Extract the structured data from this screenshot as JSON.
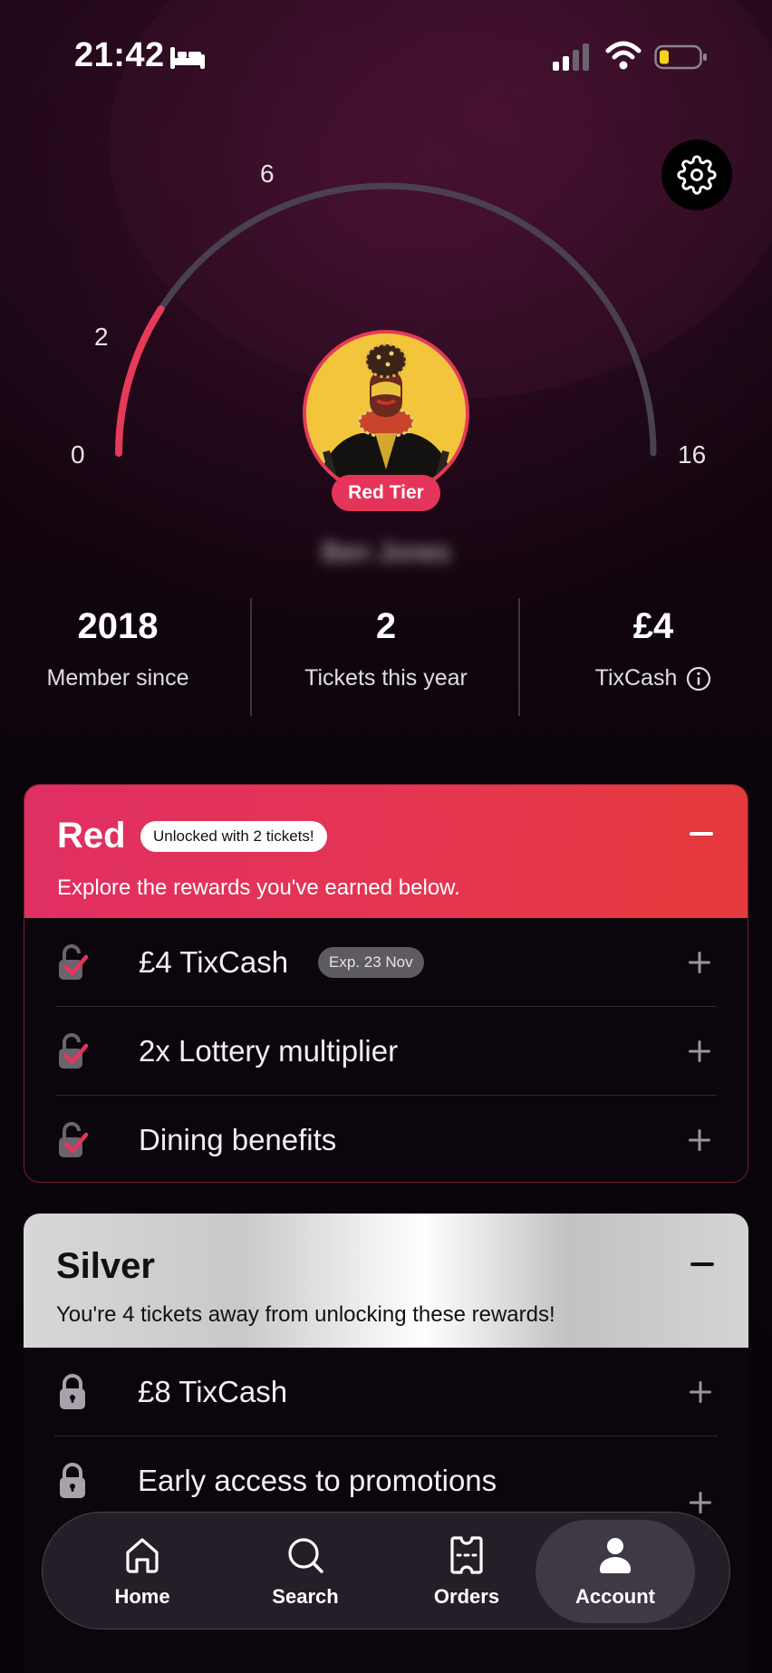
{
  "status_bar": {
    "time": "21:42"
  },
  "gauge": {
    "labels": [
      "0",
      "2",
      "6",
      "16"
    ],
    "progress_tickets": 2,
    "max_tickets": 16,
    "accent": "#e53a59"
  },
  "profile": {
    "tier_badge": "Red Tier",
    "name": "Ben Jones"
  },
  "stats": [
    {
      "value": "2018",
      "label": "Member since"
    },
    {
      "value": "2",
      "label": "Tickets this year"
    },
    {
      "value": "£4",
      "label": "TixCash"
    }
  ],
  "red_tier": {
    "title": "Red",
    "badge": "Unlocked with 2 tickets!",
    "subtitle": "Explore the rewards you've earned below.",
    "rewards": [
      {
        "label": "£4 TixCash",
        "expiry": "Exp. 23 Nov",
        "icon": "unlocked-check-icon"
      },
      {
        "label": "2x Lottery multiplier",
        "icon": "unlocked-check-icon"
      },
      {
        "label": "Dining benefits",
        "icon": "unlocked-check-icon"
      }
    ]
  },
  "silver_tier": {
    "title": "Silver",
    "subtitle": "You're 4 tickets away from unlocking these rewards!",
    "rewards": [
      {
        "label": "£8 TixCash",
        "icon": "lock-icon"
      },
      {
        "label": "Early access to promotions",
        "icon": "lock-icon"
      }
    ]
  },
  "nav": [
    {
      "label": "Home",
      "icon": "home-icon"
    },
    {
      "label": "Search",
      "icon": "search-icon"
    },
    {
      "label": "Orders",
      "icon": "ticket-icon"
    },
    {
      "label": "Account",
      "icon": "account-icon",
      "active": true
    }
  ]
}
